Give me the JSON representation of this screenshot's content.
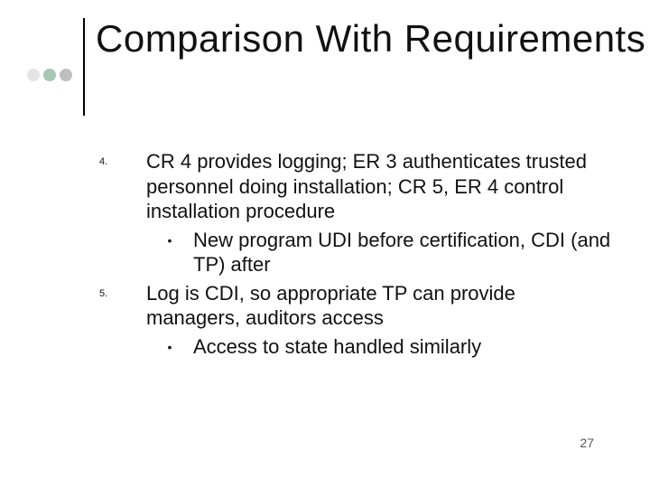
{
  "title": "Comparison With Requirements",
  "points": [
    {
      "num": "4.",
      "text": "CR 4 provides logging; ER 3 authenticates trusted personnel doing installation; CR 5, ER 4 control installation procedure",
      "sub": [
        {
          "bullet": "•",
          "text": "New program UDI before certification, CDI (and TP) after"
        }
      ]
    },
    {
      "num": "5.",
      "text": "Log is CDI, so appropriate TP can provide managers, auditors access",
      "sub": [
        {
          "bullet": "•",
          "text": "Access to state handled similarly"
        }
      ]
    }
  ],
  "page_number": "27"
}
